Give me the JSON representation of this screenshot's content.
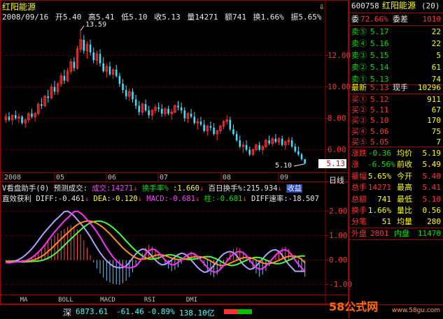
{
  "header": {
    "stock_name": "红阳能源",
    "date": "2008/09/16",
    "open": "开5.40",
    "high": "高5.41",
    "low": "低5.10",
    "close": "收5.13",
    "volume": "量14271",
    "amount": "额741",
    "turnover": "换1.66%",
    "amplitude": "振5.65%",
    "high_mark": "13.59",
    "low_mark": "5.10",
    "last_price": "5.13",
    "period": "日线"
  },
  "price_axis": [
    "12.00",
    "10.00",
    "8.00",
    "6.00"
  ],
  "time_axis": [
    "2008",
    "05",
    "06",
    "07",
    "08",
    "09"
  ],
  "indicator1": {
    "name": "V看盘助手(0)",
    "forecast": "预测成交:",
    "vol_label": "成交:14271",
    "turn_label": "换手率%",
    "turn_val": ":1.660",
    "hundred_label": "百日换手%:215.934",
    "badge": "收益"
  },
  "indicator2": {
    "name": "直效获利",
    "diff": "DIFF:-0.461",
    "dea": "DEA:-0.120",
    "macd": "MACD:-0.681",
    "zhu": "柱:-0.681",
    "rate": "DIFF速率:-18.507"
  },
  "macd_axis": [
    "2.00",
    "1.00",
    "0.00",
    "-1.00"
  ],
  "tabs": [
    "MA",
    "BOLL",
    "MACD",
    "RSI",
    "DMI"
  ],
  "status": {
    "label": "深",
    "index": "6873.61",
    "change": "-61.46",
    "pct": "-0.89%",
    "amount": "138.10亿"
  },
  "watermark": {
    "logo": "58公式网",
    "url": "www.58gu.com"
  },
  "panel": {
    "code": "600758",
    "name": "红阳能源",
    "rank": "(20)",
    "wb_label": "委",
    "wb_pct": "72.66%",
    "wc_label": "委差",
    "wc_val": "1010",
    "sells": [
      {
        "label": "卖⑤",
        "price": "5.17",
        "vol": "22"
      },
      {
        "label": "卖④",
        "price": "5.16",
        "vol": "22"
      },
      {
        "label": "卖③",
        "price": "5.15",
        "vol": "5"
      },
      {
        "label": "卖②",
        "price": "5.14",
        "vol": "61"
      },
      {
        "label": "卖①",
        "price": "5.13",
        "vol": "74"
      }
    ],
    "latest_label": "最新",
    "latest_price": "5.13",
    "current_label": "现手",
    "current_val": "10296",
    "buys": [
      {
        "label": "买①",
        "price": "5.12",
        "vol": "911"
      },
      {
        "label": "买②",
        "price": "5.11",
        "vol": "67"
      },
      {
        "label": "买③",
        "price": "5.10",
        "vol": "170"
      },
      {
        "label": "买④",
        "price": "5.06",
        "vol": "75"
      },
      {
        "label": "买⑤",
        "price": "5.05",
        "vol": "7"
      }
    ],
    "stats": [
      {
        "l1": "涨跌",
        "v1": "-0.36",
        "l2": "均价",
        "v2": "5.19"
      },
      {
        "l1": "涨",
        "v1": "-6.56%",
        "l2": "前收",
        "v2": "5.49"
      },
      {
        "l1": "振幅",
        "v1": "5.65%",
        "l2": "今开",
        "v2": "5.40"
      },
      {
        "l1": "总手",
        "v1": "14271",
        "l2": "最高",
        "v2": "5.41"
      },
      {
        "l1": "总额",
        "v1": "741",
        "l2": "最低",
        "v2": "5.10"
      },
      {
        "l1": "换手",
        "v1": "1.66%",
        "l2": "量比",
        "v2": "0.56"
      },
      {
        "l1": "分笔",
        "v1": "51",
        "l2": "均量",
        "v2": "280"
      }
    ],
    "outer_label": "外盘",
    "outer_val": "2801",
    "inner_label": "内盘",
    "inner_val": "11470"
  },
  "chart_data": {
    "type": "candlestick",
    "price_ylim": [
      4.6,
      14.2
    ],
    "candles": [
      [
        7.9,
        8.3,
        7.7,
        8.1
      ],
      [
        8.1,
        8.4,
        7.8,
        7.9
      ],
      [
        7.9,
        8.2,
        7.6,
        8.2
      ],
      [
        8.2,
        8.5,
        7.9,
        8.0
      ],
      [
        8.0,
        8.3,
        7.7,
        8.1
      ],
      [
        8.1,
        8.2,
        7.6,
        7.7
      ],
      [
        7.7,
        8.0,
        7.4,
        7.9
      ],
      [
        7.9,
        8.4,
        7.7,
        8.3
      ],
      [
        8.3,
        8.6,
        8.0,
        8.1
      ],
      [
        8.1,
        8.4,
        7.8,
        8.3
      ],
      [
        8.3,
        9.0,
        8.2,
        8.9
      ],
      [
        8.9,
        9.3,
        8.6,
        8.8
      ],
      [
        8.8,
        9.5,
        8.7,
        9.4
      ],
      [
        9.4,
        9.8,
        9.0,
        9.3
      ],
      [
        9.3,
        10.2,
        9.2,
        10.0
      ],
      [
        10.0,
        10.4,
        9.5,
        9.7
      ],
      [
        9.7,
        10.3,
        9.5,
        10.2
      ],
      [
        10.2,
        10.9,
        10.0,
        10.7
      ],
      [
        10.7,
        11.1,
        10.2,
        10.4
      ],
      [
        10.4,
        11.2,
        10.3,
        11.0
      ],
      [
        11.0,
        11.8,
        10.8,
        11.6
      ],
      [
        11.6,
        11.9,
        11.0,
        11.2
      ],
      [
        11.2,
        12.6,
        11.1,
        12.4
      ],
      [
        12.4,
        13.59,
        12.2,
        13.0
      ],
      [
        13.0,
        13.3,
        12.1,
        12.3
      ],
      [
        12.3,
        12.9,
        11.8,
        12.7
      ],
      [
        12.7,
        13.0,
        12.0,
        12.2
      ],
      [
        12.2,
        12.5,
        11.5,
        11.7
      ],
      [
        11.7,
        12.3,
        11.4,
        12.1
      ],
      [
        12.1,
        12.4,
        11.3,
        11.5
      ],
      [
        11.5,
        11.9,
        10.9,
        11.0
      ],
      [
        11.0,
        11.5,
        10.6,
        11.3
      ],
      [
        11.3,
        11.6,
        10.7,
        10.8
      ],
      [
        10.8,
        11.2,
        10.5,
        11.1
      ],
      [
        11.1,
        11.4,
        10.6,
        10.7
      ],
      [
        10.7,
        10.9,
        10.0,
        10.2
      ],
      [
        10.2,
        10.5,
        9.6,
        9.8
      ],
      [
        9.8,
        10.1,
        9.2,
        9.4
      ],
      [
        9.4,
        9.9,
        9.1,
        9.7
      ],
      [
        9.7,
        9.9,
        9.0,
        9.2
      ],
      [
        9.2,
        9.5,
        8.6,
        8.8
      ],
      [
        8.8,
        9.1,
        8.2,
        8.4
      ],
      [
        8.4,
        9.0,
        8.2,
        8.9
      ],
      [
        8.9,
        9.2,
        8.4,
        8.5
      ],
      [
        8.5,
        8.8,
        8.0,
        8.2
      ],
      [
        8.2,
        8.6,
        7.9,
        8.5
      ],
      [
        8.5,
        8.9,
        8.3,
        8.7
      ],
      [
        8.7,
        9.0,
        8.4,
        8.6
      ],
      [
        8.6,
        8.9,
        8.1,
        8.3
      ],
      [
        8.3,
        8.7,
        8.1,
        8.6
      ],
      [
        8.6,
        8.8,
        8.2,
        8.3
      ],
      [
        8.3,
        8.6,
        7.9,
        8.4
      ],
      [
        8.4,
        8.9,
        8.3,
        8.8
      ],
      [
        8.8,
        9.1,
        8.5,
        8.7
      ],
      [
        8.7,
        9.0,
        8.3,
        8.5
      ],
      [
        8.5,
        8.7,
        7.8,
        8.0
      ],
      [
        8.0,
        8.4,
        7.7,
        8.3
      ],
      [
        8.3,
        8.6,
        8.0,
        8.1
      ],
      [
        8.1,
        8.4,
        7.6,
        7.7
      ],
      [
        7.7,
        8.0,
        7.3,
        7.8
      ],
      [
        7.8,
        8.1,
        7.5,
        7.6
      ],
      [
        7.6,
        7.9,
        7.1,
        7.2
      ],
      [
        7.2,
        7.6,
        6.9,
        7.5
      ],
      [
        7.5,
        7.8,
        7.2,
        7.4
      ],
      [
        7.4,
        7.7,
        6.9,
        7.0
      ],
      [
        7.0,
        7.3,
        6.6,
        7.2
      ],
      [
        7.2,
        7.6,
        7.0,
        7.5
      ],
      [
        7.5,
        7.9,
        7.3,
        7.8
      ],
      [
        7.8,
        8.2,
        7.6,
        7.9
      ],
      [
        7.9,
        8.1,
        7.2,
        7.3
      ],
      [
        7.3,
        7.6,
        6.9,
        7.0
      ],
      [
        7.0,
        7.2,
        6.5,
        6.6
      ],
      [
        6.6,
        6.9,
        6.1,
        6.2
      ],
      [
        6.2,
        6.5,
        5.8,
        6.3
      ],
      [
        6.3,
        6.6,
        5.9,
        6.0
      ],
      [
        6.0,
        6.2,
        5.6,
        5.7
      ],
      [
        5.7,
        6.1,
        5.6,
        6.0
      ],
      [
        6.0,
        6.4,
        5.9,
        6.3
      ],
      [
        6.3,
        6.5,
        5.9,
        6.0
      ],
      [
        6.0,
        6.3,
        5.7,
        6.2
      ],
      [
        6.2,
        6.7,
        6.1,
        6.6
      ],
      [
        6.6,
        6.9,
        6.3,
        6.4
      ],
      [
        6.4,
        6.8,
        6.2,
        6.7
      ],
      [
        6.7,
        7.0,
        6.4,
        6.5
      ],
      [
        6.5,
        6.8,
        6.3,
        6.7
      ],
      [
        6.7,
        6.9,
        6.2,
        6.3
      ],
      [
        6.3,
        6.6,
        6.0,
        6.5
      ],
      [
        6.5,
        6.8,
        6.3,
        6.6
      ],
      [
        6.6,
        6.8,
        6.1,
        6.2
      ],
      [
        6.2,
        6.4,
        5.8,
        5.9
      ],
      [
        5.9,
        6.2,
        5.6,
        5.7
      ],
      [
        5.7,
        5.8,
        5.3,
        5.4
      ],
      [
        5.4,
        5.41,
        5.1,
        5.13
      ]
    ],
    "macd_ylim": [
      -1.3,
      2.3
    ],
    "macd_bars": [
      -0.05,
      -0.08,
      -0.04,
      -0.06,
      -0.03,
      -0.02,
      0.0,
      0.05,
      0.12,
      0.2,
      0.32,
      0.45,
      0.6,
      0.75,
      0.88,
      1.0,
      1.1,
      1.2,
      1.28,
      1.35,
      1.42,
      1.38,
      1.25,
      1.05,
      0.8,
      0.5,
      0.2,
      -0.1,
      -0.35,
      -0.55,
      -0.72,
      -0.85,
      -0.92,
      -0.98,
      -1.0,
      -1.02,
      -0.95,
      -0.85,
      -0.7,
      -0.5,
      -0.25,
      0.05,
      0.3,
      0.5,
      0.62,
      0.55,
      0.4,
      0.2,
      0.0,
      -0.2,
      -0.35,
      -0.45,
      -0.4,
      -0.3,
      -0.15,
      0.05,
      0.25,
      0.35,
      0.3,
      0.15,
      -0.05,
      -0.25,
      -0.45,
      -0.62,
      -0.7,
      -0.6,
      -0.4,
      -0.15,
      0.1,
      0.3,
      0.45,
      0.52,
      0.48,
      0.35,
      0.15,
      -0.1,
      -0.35,
      -0.55,
      -0.68,
      -0.6,
      -0.45,
      -0.25,
      0.0,
      0.2,
      0.38,
      0.5,
      0.55,
      0.45,
      0.25,
      0.0,
      -0.3,
      -0.5,
      -0.68
    ],
    "diff": [
      -0.1,
      -0.12,
      -0.1,
      -0.08,
      -0.06,
      -0.05,
      -0.03,
      0.02,
      0.1,
      0.2,
      0.32,
      0.46,
      0.62,
      0.8,
      0.98,
      1.15,
      1.3,
      1.45,
      1.6,
      1.72,
      1.85,
      1.98,
      2.0,
      1.92,
      1.8,
      1.65,
      1.5,
      1.33,
      1.15,
      0.95,
      0.72,
      0.5,
      0.3,
      0.12,
      -0.03,
      -0.15,
      -0.25,
      -0.3,
      -0.32,
      -0.3,
      -0.25,
      -0.1,
      0.08,
      0.25,
      0.38,
      0.45,
      0.42,
      0.3,
      0.15,
      0.0,
      -0.12,
      -0.2,
      -0.18,
      -0.1,
      0.0,
      0.12,
      0.22,
      0.28,
      0.25,
      0.15,
      0.0,
      -0.15,
      -0.3,
      -0.42,
      -0.5,
      -0.48,
      -0.38,
      -0.22,
      -0.05,
      0.12,
      0.25,
      0.32,
      0.35,
      0.3,
      0.18,
      0.0,
      -0.18,
      -0.3,
      -0.38,
      -0.35,
      -0.25,
      -0.1,
      0.05,
      0.2,
      0.32,
      0.4,
      0.42,
      0.35,
      0.2,
      0.0,
      -0.18,
      -0.32,
      -0.461
    ],
    "dea": [
      -0.05,
      -0.07,
      -0.08,
      -0.08,
      -0.07,
      -0.06,
      -0.05,
      -0.04,
      -0.02,
      0.02,
      0.08,
      0.15,
      0.24,
      0.35,
      0.47,
      0.6,
      0.73,
      0.86,
      0.99,
      1.11,
      1.23,
      1.35,
      1.45,
      1.52,
      1.57,
      1.59,
      1.59,
      1.56,
      1.5,
      1.42,
      1.32,
      1.2,
      1.07,
      0.93,
      0.78,
      0.64,
      0.5,
      0.38,
      0.27,
      0.17,
      0.09,
      0.04,
      0.03,
      0.05,
      0.09,
      0.14,
      0.19,
      0.21,
      0.21,
      0.18,
      0.13,
      0.08,
      0.04,
      0.02,
      0.02,
      0.04,
      0.07,
      0.1,
      0.13,
      0.14,
      0.13,
      0.09,
      0.03,
      -0.04,
      -0.12,
      -0.18,
      -0.22,
      -0.22,
      -0.19,
      -0.13,
      -0.07,
      -0.01,
      0.05,
      0.09,
      0.11,
      0.1,
      0.06,
      0.0,
      -0.06,
      -0.12,
      -0.15,
      -0.15,
      -0.12,
      -0.07,
      -0.01,
      0.05,
      0.11,
      0.15,
      0.17,
      0.16,
      0.11,
      0.03,
      -0.12
    ]
  }
}
